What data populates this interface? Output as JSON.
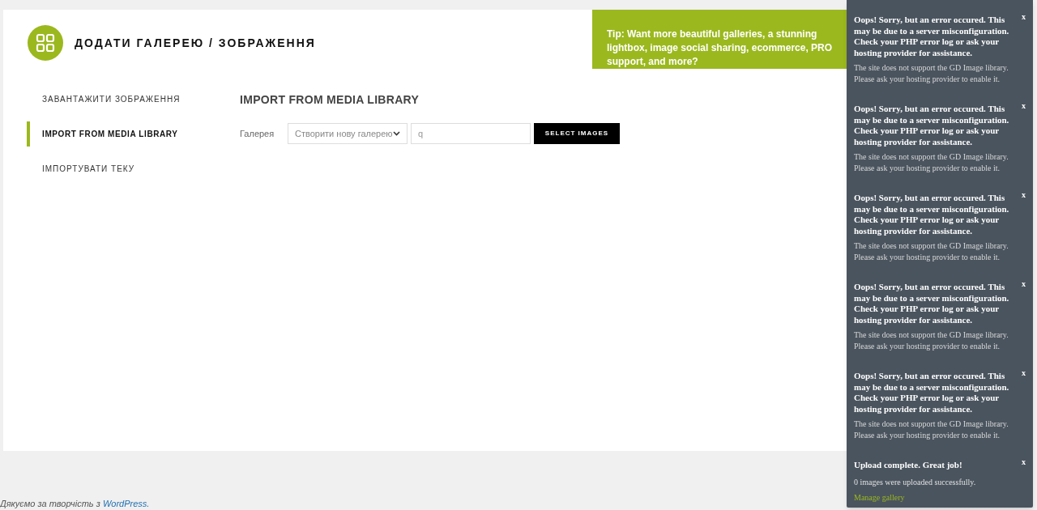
{
  "header": {
    "title": "ДОДАТИ ГАЛЕРЕЮ / ЗОБРАЖЕННЯ",
    "tip": "Tip: Want more beautiful galleries, a stunning lightbox, image social sharing, ecommerce, PRO support, and more?"
  },
  "sidebar": {
    "items": [
      {
        "label": "ЗАВАНТАЖИТИ ЗОБРАЖЕННЯ",
        "selected": false
      },
      {
        "label": "IMPORT FROM MEDIA LIBRARY",
        "selected": true
      },
      {
        "label": "ІМПОРТУВАТИ ТЕКУ",
        "selected": false
      }
    ]
  },
  "panel": {
    "heading": "IMPORT FROM MEDIA LIBRARY",
    "gallery_label": "Галерея",
    "gallery_select": "Створити нову галерею",
    "name_field": {
      "value": "q"
    },
    "button": "SELECT IMAGES"
  },
  "notifications": [
    {
      "kind": "error",
      "title": "Oops! Sorry, but an error occured. This may be due to a server misconfiguration. Check your PHP error log or ask your hosting provider for assistance.",
      "message": "The site does not support the GD Image library. Please ask your hosting provider to enable it.",
      "close": "x"
    },
    {
      "kind": "error",
      "title": "Oops! Sorry, but an error occured. This may be due to a server misconfiguration. Check your PHP error log or ask your hosting provider for assistance.",
      "message": "The site does not support the GD Image library. Please ask your hosting provider to enable it.",
      "close": "x"
    },
    {
      "kind": "error",
      "title": "Oops! Sorry, but an error occured. This may be due to a server misconfiguration. Check your PHP error log or ask your hosting provider for assistance.",
      "message": "The site does not support the GD Image library. Please ask your hosting provider to enable it.",
      "close": "x"
    },
    {
      "kind": "error",
      "title": "Oops! Sorry, but an error occured. This may be due to a server misconfiguration. Check your PHP error log or ask your hosting provider for assistance.",
      "message": "The site does not support the GD Image library. Please ask your hosting provider to enable it.",
      "close": "x"
    },
    {
      "kind": "error",
      "title": "Oops! Sorry, but an error occured. This may be due to a server misconfiguration. Check your PHP error log or ask your hosting provider for assistance.",
      "message": "The site does not support the GD Image library. Please ask your hosting provider to enable it.",
      "close": "x"
    },
    {
      "kind": "success",
      "title": "Upload complete. Great job!",
      "message": "0 images were uploaded successfully.",
      "link": "Manage gallery",
      "close": "x"
    }
  ],
  "footer": {
    "text": "Дякуємо за творчість з",
    "link": "WordPress."
  }
}
